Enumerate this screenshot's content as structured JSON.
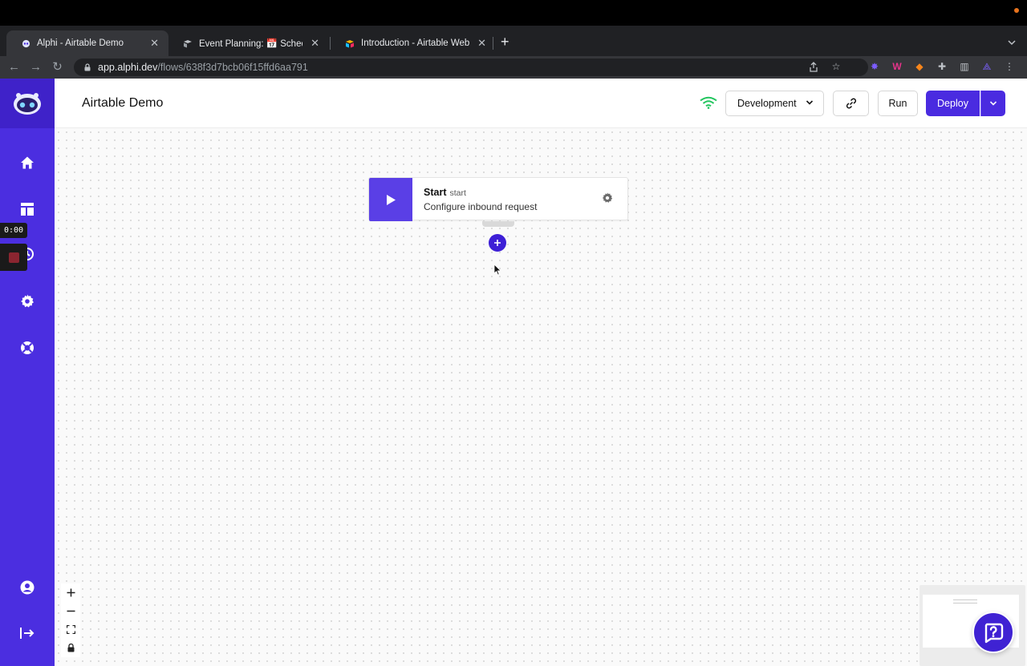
{
  "browser": {
    "tabs": [
      {
        "title": "Alphi - Airtable Demo",
        "favicon": "alphi-favicon",
        "active": true
      },
      {
        "title": "Event Planning: 📅 Schedule - ",
        "favicon": "airtable-favicon",
        "active": false
      },
      {
        "title": "Introduction - Airtable Web API",
        "favicon": "airtable-logo-favicon",
        "active": false
      }
    ],
    "new_tab_label": "+",
    "url_host": "app.alphi.dev",
    "url_path": "/flows/638f3d7bcb06f15ffd6aa791"
  },
  "recorder": {
    "time": "0:00"
  },
  "header": {
    "title": "Airtable Demo",
    "environment": "Development",
    "run_label": "Run",
    "deploy_label": "Deploy",
    "connection_color": "#22c55e"
  },
  "node": {
    "title": "Start",
    "type": "start",
    "subtitle": "Configure inbound request"
  },
  "colors": {
    "brand": "#4b2ee0",
    "brand_dark": "#3f22c9"
  }
}
